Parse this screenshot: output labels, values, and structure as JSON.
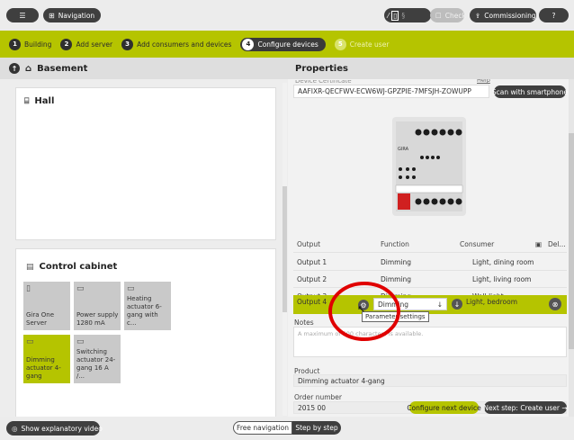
{
  "topbar": {
    "menu_icon": "hamburger-icon",
    "nav_label": "Navigation",
    "nav_icon": "grid-icon",
    "check_label": "Check",
    "commissioning_label": "Commissioning",
    "help_label": "?"
  },
  "steps": [
    {
      "num": "1",
      "label": "Building"
    },
    {
      "num": "2",
      "label": "Add server"
    },
    {
      "num": "3",
      "label": "Add consumers and devices"
    },
    {
      "num": "4",
      "label": "Configure devices"
    },
    {
      "num": "5",
      "label": "Create user"
    }
  ],
  "left": {
    "title": "Basement",
    "hall": "Hall",
    "cabinet": "Control cabinet",
    "tiles": [
      {
        "label": "Gira One Server"
      },
      {
        "label": "Power supply 1280 mA"
      },
      {
        "label": "Heating actuator 6-gang with c..."
      },
      {
        "label": "Dimming actuator 4-gang"
      },
      {
        "label": "Switching actuator 24-gang 16 A /..."
      }
    ]
  },
  "right": {
    "title": "Properties",
    "cert_label": "Device Certificate",
    "cert_link": "Help",
    "cert_value": "AAFIXR-QECFWV-ECW6WJ-GPZPIE-7MFSJH-ZOWUPP",
    "scan_label": "Scan with smartphone",
    "device": {
      "brand": "GIRA",
      "model": "Dimming actuator 4-gang"
    },
    "table": {
      "headers": [
        "Output",
        "Function",
        "Consumer",
        "Del..."
      ],
      "rows": [
        {
          "output": "Output 1",
          "function": "Dimming",
          "consumer": "Light, dining room"
        },
        {
          "output": "Output 2",
          "function": "Dimming",
          "consumer": "Light, living room"
        },
        {
          "output": "Output 3",
          "function": "Dimming",
          "consumer": "Wall light"
        },
        {
          "output": "Output 4",
          "function": "Dimming",
          "consumer": "Light, bedroom"
        }
      ]
    },
    "tooltip": "Parameter settings",
    "notes_label": "Notes",
    "notes_placeholder": "A maximum of 500 characters is available.",
    "product_label": "Product",
    "product_value": "Dimming actuator 4-gang",
    "order_label": "Order number",
    "order_value": "2015 00",
    "configure_next": "Configure next device",
    "next_step": "Next step: Create user →"
  },
  "bottom": {
    "video_label": "Show explanatory video",
    "free_nav": "Free navigation",
    "step_by_step": "Step by step"
  },
  "colors": {
    "accent": "#b5c400",
    "dark": "#3f3f3f",
    "annotation": "#e00000"
  }
}
